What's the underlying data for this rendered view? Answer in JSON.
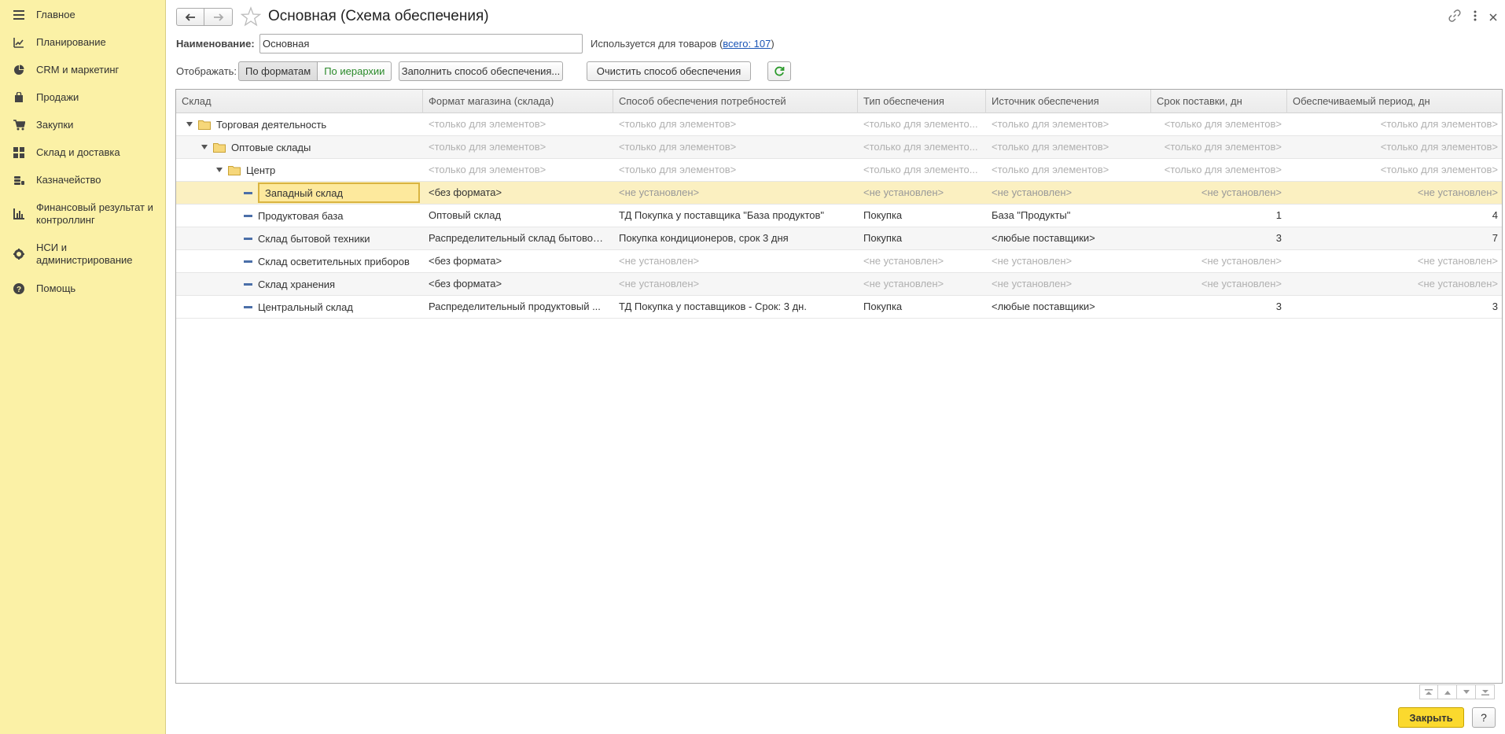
{
  "sidebar": {
    "items": [
      {
        "label": "Главное",
        "icon": "menu-icon"
      },
      {
        "label": "Планирование",
        "icon": "planning-icon"
      },
      {
        "label": "CRM и маркетинг",
        "icon": "pie-chart-icon"
      },
      {
        "label": "Продажи",
        "icon": "shopping-bag-icon"
      },
      {
        "label": "Закупки",
        "icon": "cart-icon"
      },
      {
        "label": "Склад и доставка",
        "icon": "grid-icon"
      },
      {
        "label": "Казначейство",
        "icon": "coins-icon"
      },
      {
        "label": "Финансовый результат и контроллинг",
        "icon": "bar-chart-icon"
      },
      {
        "label": "НСИ и администрирование",
        "icon": "gear-icon"
      },
      {
        "label": "Помощь",
        "icon": "help-icon"
      }
    ]
  },
  "header": {
    "title": "Основная (Схема обеспечения)"
  },
  "form": {
    "name_label": "Наименование:",
    "name_value": "Основная",
    "used_prefix": "Используется для товаров (",
    "used_link": "всего: 107",
    "used_suffix": ")",
    "show_label": "Отображать:",
    "seg_left": "По форматам",
    "seg_right": "По иерархии",
    "fill_button": "Заполнить способ обеспечения...",
    "clear_button": "Очистить способ обеспечения"
  },
  "table": {
    "columns": [
      "Склад",
      "Формат магазина (склада)",
      "Способ обеспечения потребностей",
      "Тип обеспечения",
      "Источник обеспечения",
      "Срок поставки, дн",
      "Обеспечиваемый период, дн"
    ],
    "rows": [
      {
        "name": "Торговая деятельность",
        "format": "<только для элементов>",
        "method": "<только для элементов>",
        "type": "<только для элементо...",
        "source": "<только для элементов>",
        "term": "<только для элементов>",
        "period": "<только для элементов>"
      },
      {
        "name": "Оптовые склады",
        "format": "<только для элементов>",
        "method": "<только для элементов>",
        "type": "<только для элементо...",
        "source": "<только для элементов>",
        "term": "<только для элементов>",
        "period": "<только для элементов>"
      },
      {
        "name": "Центр",
        "format": "<только для элементов>",
        "method": "<только для элементов>",
        "type": "<только для элементо...",
        "source": "<только для элементов>",
        "term": "<только для элементов>",
        "period": "<только для элементов>"
      },
      {
        "name": "Западный склад",
        "format": "<без формата>",
        "method": "<не установлен>",
        "type": "<не установлен>",
        "source": "<не установлен>",
        "term": "<не установлен>",
        "period": "<не установлен>"
      },
      {
        "name": "Продуктовая база",
        "format": "Оптовый склад",
        "method": "ТД Покупка у поставщика \"База продуктов\"",
        "type": "Покупка",
        "source": "База \"Продукты\"",
        "term": "1",
        "period": "4"
      },
      {
        "name": "Склад бытовой техники",
        "format": "Распределительный склад бытовой ...",
        "method": "Покупка кондиционеров, срок 3 дня",
        "type": "Покупка",
        "source": "<любые поставщики>",
        "term": "3",
        "period": "7"
      },
      {
        "name": "Склад осветительных приборов",
        "format": "<без формата>",
        "method": "<не установлен>",
        "type": "<не установлен>",
        "source": "<не установлен>",
        "term": "<не установлен>",
        "period": "<не установлен>"
      },
      {
        "name": "Склад хранения",
        "format": "<без формата>",
        "method": "<не установлен>",
        "type": "<не установлен>",
        "source": "<не установлен>",
        "term": "<не установлен>",
        "period": "<не установлен>"
      },
      {
        "name": "Центральный склад",
        "format": "Распределительный продуктовый ...",
        "method": "ТД Покупка у поставщиков - Срок: 3 дн.",
        "type": "Покупка",
        "source": "<любые поставщики>",
        "term": "3",
        "period": "3"
      }
    ]
  },
  "footer": {
    "close_button": "Закрыть",
    "help_button": "?"
  }
}
